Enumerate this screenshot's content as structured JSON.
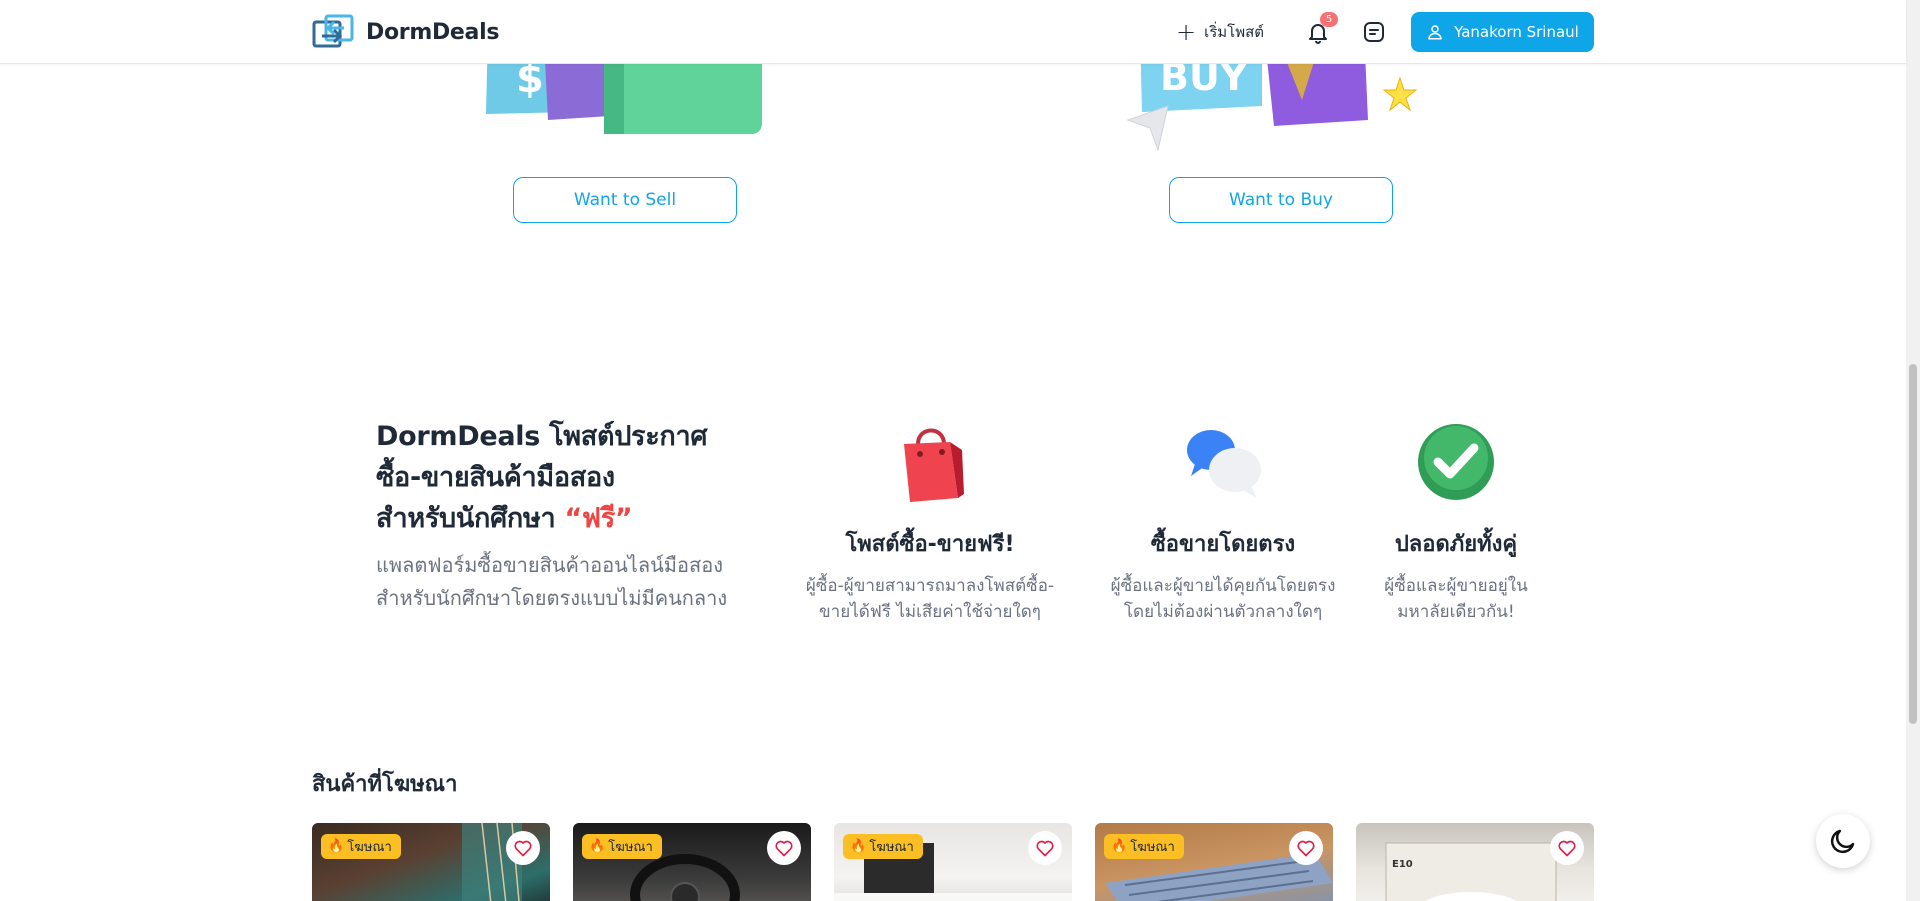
{
  "header": {
    "brand": "DormDeals",
    "post_label": "เริ่มโพสต์",
    "notification_count": "5",
    "user_name": "Yanakorn Srinaul"
  },
  "hero": {
    "sell_label": "Want to Sell",
    "buy_label": "Want to Buy",
    "buy_sign_text": "BUY"
  },
  "intro": {
    "title_line1": "DormDeals โพสต์ประกาศ",
    "title_line2": "ซื้อ-ขายสินค้ามือสอง",
    "title_line3": "สำหรับนักศึกษา ",
    "title_free": "“ฟรี”",
    "description": "แพลตฟอร์มซื้อขายสินค้าออนไลน์มือสองสำหรับนักศึกษาโดยตรงแบบไม่มีคนกลาง"
  },
  "features": [
    {
      "icon": "shopping-bag-icon",
      "title": "โพสต์ซื้อ-ขายฟรี!",
      "desc": "ผู้ซื้อ-ผู้ขายสามารถมาลงโพสต์ซื้อ-ขายได้ฟรี ไม่เสียค่าใช้จ่ายใดๆ"
    },
    {
      "icon": "chat-bubbles-icon",
      "title": "ซื้อขายโดยตรง",
      "desc": "ผู้ซื้อและผู้ขายได้คุยกันโดยตรงโดยไม่ต้องผ่านตัวกลางใดๆ"
    },
    {
      "icon": "check-circle-icon",
      "title": "ปลอดภัยทั้งคู่",
      "desc": "ผู้ซื้อและผู้ขายอยู่ในมหาลัยเดียวกัน!"
    }
  ],
  "ads": {
    "title": "สินค้าที่โฆษณา",
    "tag_label": "โฆษณา",
    "card5_label": "E10"
  },
  "colors": {
    "primary": "#0ea5e9",
    "free_red": "#ef4444",
    "ad_tag": "#fbbf24"
  }
}
